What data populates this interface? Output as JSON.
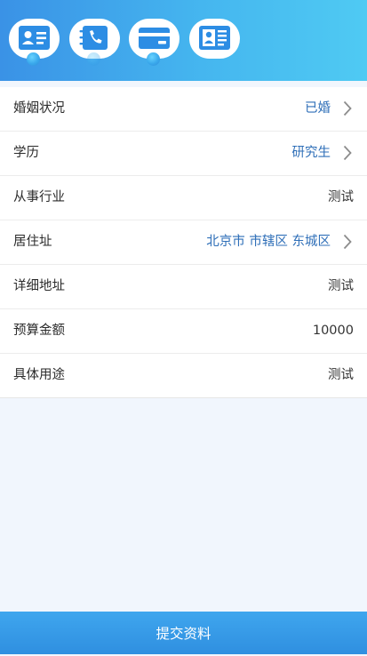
{
  "steps": [
    {
      "icon": "id-card-icon"
    },
    {
      "icon": "phone-book-icon"
    },
    {
      "icon": "bank-card-icon"
    },
    {
      "icon": "personal-info-icon"
    }
  ],
  "form": {
    "marital": {
      "label": "婚姻状况",
      "value": "已婚"
    },
    "education": {
      "label": "学历",
      "value": "研究生"
    },
    "industry": {
      "label": "从事行业",
      "value": "测试"
    },
    "residence": {
      "label": "居住址",
      "value": "北京市 市辖区 东城区"
    },
    "address": {
      "label": "详细地址",
      "value": "测试"
    },
    "budget": {
      "label": "预算金额",
      "value": "10000"
    },
    "purpose": {
      "label": "具体用途",
      "value": "测试"
    }
  },
  "footer": {
    "submit_label": "提交资料"
  },
  "colors": {
    "accent": "#3a92e6",
    "link": "#2f6fb8",
    "background": "#f1f6fd"
  }
}
